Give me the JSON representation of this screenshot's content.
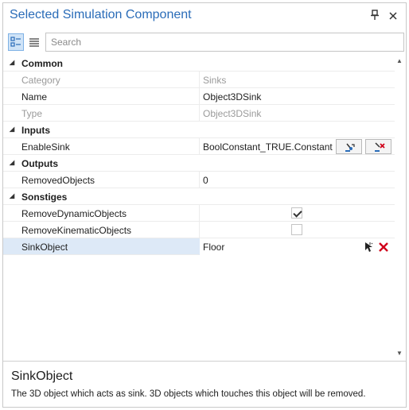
{
  "panel": {
    "title": "Selected Simulation Component"
  },
  "toolbar": {
    "search_placeholder": "Search"
  },
  "categories": {
    "common": "Common",
    "inputs": "Inputs",
    "outputs": "Outputs",
    "sonstiges": "Sonstiges"
  },
  "props": {
    "category": {
      "name": "Category",
      "value": "Sinks"
    },
    "name": {
      "name": "Name",
      "value": "Object3DSink"
    },
    "type": {
      "name": "Type",
      "value": "Object3DSink"
    },
    "enable_sink": {
      "name": "EnableSink",
      "value": "BoolConstant_TRUE.Constant"
    },
    "removed_objects": {
      "name": "RemovedObjects",
      "value": "0"
    },
    "remove_dynamic": {
      "name": "RemoveDynamicObjects",
      "checked": true
    },
    "remove_kinematic": {
      "name": "RemoveKinematicObjects",
      "checked": false
    },
    "sink_object": {
      "name": "SinkObject",
      "value": "Floor"
    }
  },
  "description": {
    "title": "SinkObject",
    "text": "The 3D object which acts as sink. 3D objects which touches this object will be removed."
  },
  "colors": {
    "title": "#2a6cb8",
    "selected_row": "#dde9f7",
    "delete_icon": "#d0021b"
  }
}
